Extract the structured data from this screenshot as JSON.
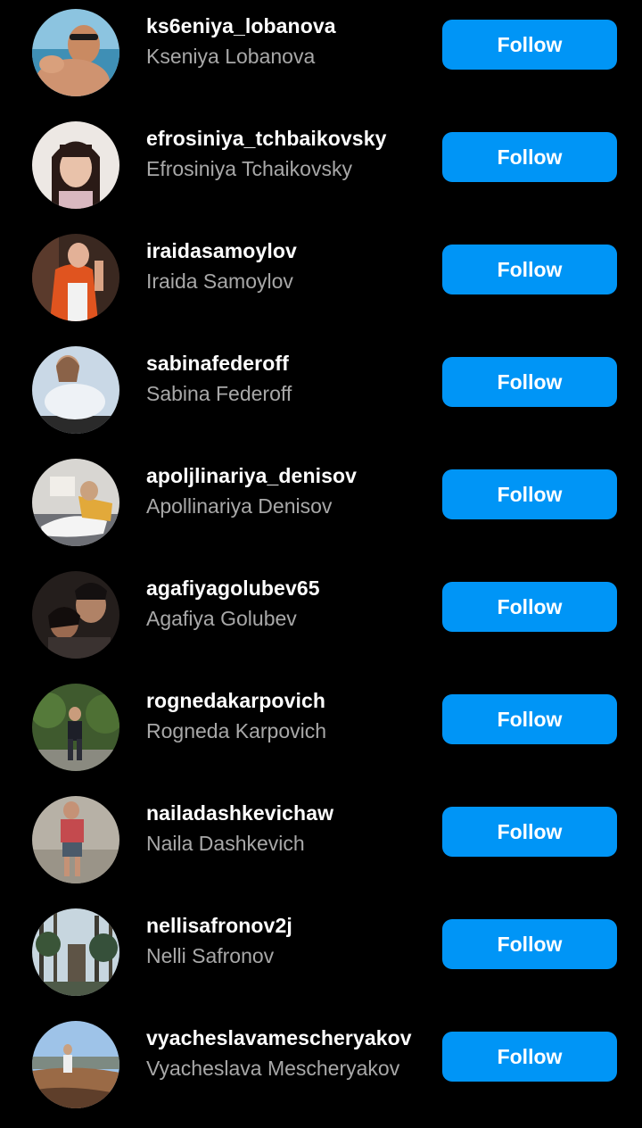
{
  "colors": {
    "background": "#000000",
    "username": "#ffffff",
    "fullname": "#a8a8a8",
    "follow_button": "#0095f6",
    "follow_text": "#ffffff"
  },
  "suggestions": [
    {
      "username": "ks6eniya_lobanova",
      "fullname": "Kseniya Lobanova",
      "button": "Follow"
    },
    {
      "username": "efrosiniya_tchbaikovsky",
      "fullname": "Efrosiniya Tchaikovsky",
      "button": "Follow"
    },
    {
      "username": "iraidasamoylov",
      "fullname": "Iraida Samoylov",
      "button": "Follow"
    },
    {
      "username": "sabinafederoff",
      "fullname": "Sabina Federoff",
      "button": "Follow"
    },
    {
      "username": "apoljlinariya_denisov",
      "fullname": "Apollinariya Denisov",
      "button": "Follow"
    },
    {
      "username": "agafiyagolubev65",
      "fullname": "Agafiya Golubev",
      "button": "Follow"
    },
    {
      "username": "rognedakarpovich",
      "fullname": "Rogneda Karpovich",
      "button": "Follow"
    },
    {
      "username": "nailadashkevichaw",
      "fullname": "Naila Dashkevich",
      "button": "Follow"
    },
    {
      "username": "nellisafronov2j",
      "fullname": "Nelli Safronov",
      "button": "Follow"
    },
    {
      "username": "vyacheslavamescheryakov",
      "fullname": "Vyacheslava Mescheryakov",
      "button": "Follow"
    }
  ]
}
